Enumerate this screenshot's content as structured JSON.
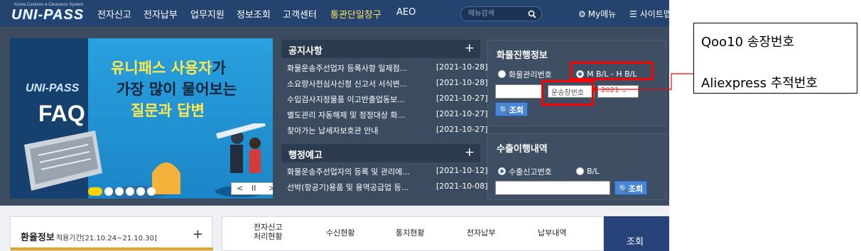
{
  "header": {
    "logo_sub": "Korea Customs e-Clearance System",
    "logo_main": "UNI-PASS",
    "nav": [
      "전자신고",
      "전자납부",
      "업무지원",
      "정보조회",
      "고객센터",
      "통관단일창구",
      "AEO"
    ],
    "search_placeholder": "메뉴검색",
    "my_menu": "My메뉴",
    "sitemap": "사이트맵"
  },
  "banner": {
    "logo": "UNI-PASS",
    "faq": "FAQ",
    "line1_a": "유니패스 사용자",
    "line1_b": "가",
    "line2": "가장 많이 물어보는",
    "line3": "질문과 답변",
    "pause": "II",
    "prev": "<",
    "next": ">"
  },
  "notice": {
    "title": "공지사항",
    "plus": "+",
    "items": [
      {
        "title": "화물운송주선업자 등록사항 일제점...",
        "date": "[2021-10-28]"
      },
      {
        "title": "소요량사전심사신청 신고서 서식변...",
        "date": "[2021-10-28]"
      },
      {
        "title": "수입검사지정물품 이고반출업동보...",
        "date": "[2021-10-27]"
      },
      {
        "title": "별도관리 자동해제 및 정정대상 화...",
        "date": "[2021-10-27]"
      },
      {
        "title": "찾아가는 납세자보호관 안내",
        "date": "[2021-10-27]"
      }
    ]
  },
  "admin_notice": {
    "title": "행정예고",
    "plus": "+",
    "items": [
      {
        "title": "화물운송주선업자의 등록 및 관리에...",
        "date": "[2021-10-12]"
      },
      {
        "title": "선박(항공기)용품 및 용역공급업 등...",
        "date": "[2021-10-08]"
      }
    ]
  },
  "cargo": {
    "title": "화물진행정보",
    "radio1": "화물관리번호",
    "radio2": "M B/L - H B/L",
    "tracking_select": "운송장번호",
    "year_select": "2021",
    "search_button": "조회"
  },
  "export": {
    "title": "수출이행내역",
    "radio1": "수출신고번호",
    "radio2": "B/L",
    "search_button": "조회"
  },
  "bottom": {
    "rate_title": "환율정보",
    "rate_period": "적용기간[21.10.24~21.10.30]",
    "rate_plus": "+",
    "services": [
      {
        "line1": "전자신고",
        "line2": "처리현황"
      },
      {
        "line1": "수신현황",
        "line2": ""
      },
      {
        "line1": "통지현황",
        "line2": ""
      },
      {
        "line1": "전자납부",
        "line2": ""
      },
      {
        "line1": "납부내역",
        "line2": ""
      }
    ],
    "service_button": "조회"
  },
  "annotation": {
    "line1": "Qoo10 송장번호",
    "line2": "Aliexpress 추적번호"
  },
  "colors": {
    "nav_bg": "#24436e",
    "panel_bg": "#3b4c60",
    "highlight": "#ff0000",
    "accent_yellow": "#ffe84a"
  }
}
